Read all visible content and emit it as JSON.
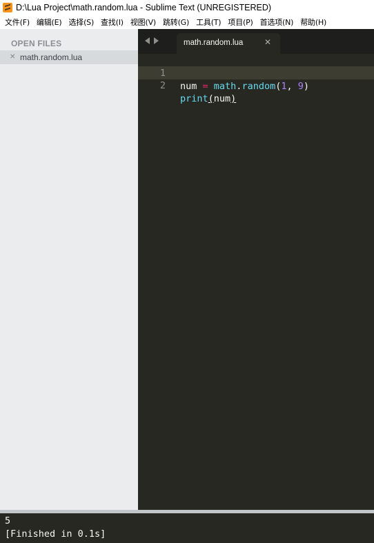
{
  "window": {
    "title": "D:\\Lua Project\\math.random.lua - Sublime Text (UNREGISTERED)",
    "icon": "sublime-text-icon"
  },
  "menu": {
    "items": [
      "文件(F)",
      "编辑(E)",
      "选择(S)",
      "查找(I)",
      "视图(V)",
      "跳转(G)",
      "工具(T)",
      "项目(P)",
      "首选项(N)",
      "帮助(H)"
    ]
  },
  "sidebar": {
    "header": "OPEN FILES",
    "files": [
      {
        "label": "math.random.lua",
        "close_icon": "close-icon"
      }
    ]
  },
  "tabs": {
    "items": [
      {
        "label": "math.random.lua",
        "active": true
      }
    ]
  },
  "editor": {
    "lines": [
      {
        "number": "1",
        "tokens": [
          "num",
          " = ",
          "math",
          ".",
          "random",
          "(",
          "1",
          ", ",
          "9",
          ")"
        ]
      },
      {
        "number": "2",
        "tokens": [
          "print",
          "(",
          "num",
          ")"
        ]
      }
    ],
    "current_line": "2"
  },
  "output": {
    "lines": [
      "5",
      "[Finished in 0.1s]"
    ]
  },
  "colors": {
    "editor_bg": "#272822",
    "keyword_op": "#f92672",
    "function": "#66d9ef",
    "number": "#ae81ff",
    "text": "#f8f8f2",
    "sidebar_bg": "#eaeced"
  }
}
